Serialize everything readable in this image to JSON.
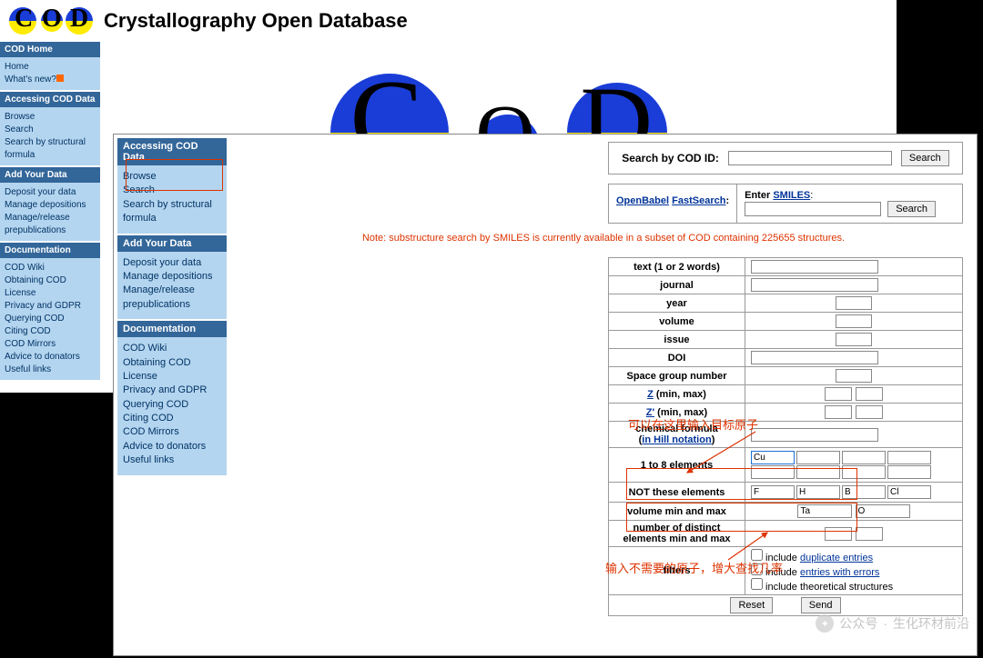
{
  "header": {
    "site_title": "Crystallography Open Database"
  },
  "sidebar1": {
    "cod_home": {
      "header": "COD Home",
      "home": "Home",
      "whats_new": "What's new?"
    },
    "accessing": {
      "header": "Accessing COD Data",
      "browse": "Browse",
      "search": "Search",
      "search_formula": "Search by structural formula"
    },
    "add": {
      "header": "Add Your Data",
      "deposit": "Deposit your data",
      "manage_dep": "Manage depositions",
      "manage_rel": "Manage/release prepublications"
    },
    "doc": {
      "header": "Documentation",
      "wiki": "COD Wiki",
      "obtaining": "Obtaining COD",
      "license": "License",
      "privacy": "Privacy and GDPR",
      "querying": "Querying COD",
      "citing": "Citing COD",
      "mirrors": "COD Mirrors",
      "advice": "Advice to donators",
      "useful": "Useful links"
    }
  },
  "sidebar2": {
    "accessing": {
      "header": "Accessing COD Data",
      "browse": "Browse",
      "search": "Search",
      "search_formula": "Search by structural formula"
    },
    "add": {
      "header": "Add Your Data",
      "deposit": "Deposit your data",
      "manage_dep": "Manage depositions",
      "manage_rel": "Manage/release prepublications"
    },
    "doc": {
      "header": "Documentation",
      "wiki": "COD Wiki",
      "obtaining": "Obtaining COD",
      "license": "License",
      "privacy": "Privacy and GDPR",
      "querying": "Querying COD",
      "citing": "Citing COD",
      "mirrors": "COD Mirrors",
      "advice": "Advice to donators",
      "useful": "Useful links"
    }
  },
  "search_cod_id": {
    "label": "Search by COD ID:",
    "button": "Search"
  },
  "smiles": {
    "openbabel": "OpenBabel",
    "fastsearch": "FastSearch",
    "enter": "Enter ",
    "smiles_link": "SMILES",
    "colon": ":",
    "button": "Search"
  },
  "note": "Note: substructure search by SMILES is currently available in a subset of COD containing 225655 structures.",
  "form": {
    "text": "text (1 or 2 words)",
    "journal": "journal",
    "year": "year",
    "volume": "volume",
    "issue": "issue",
    "doi": "DOI",
    "sg": "Space group number",
    "z": "Z",
    "z_suffix": " (min, max)",
    "zprime": "Z'",
    "zprime_suffix": " (min, max)",
    "formula": "chemical formula",
    "in_hill": "in Hill notation",
    "elements": "1 to 8 elements",
    "not_elements": "NOT these elements",
    "vol_minmax": "volume min and max",
    "distinct": "number of distinct elements min and max",
    "filters": "filters",
    "f_dup_prefix": " include ",
    "f_dup": "duplicate entries",
    "f_err_prefix": " include ",
    "f_err": "entries with errors",
    "f_theo": " include theoretical structures",
    "reset": "Reset",
    "send": "Send",
    "cu": "Cu",
    "ne_f": "F",
    "ne_h": "H",
    "ne_b": "B",
    "ne_cl": "Cl",
    "v1": "Ta",
    "v2": "O"
  },
  "annotations": {
    "target_atoms": "可以在这里输入目标原子",
    "exclude_atoms": "输入不需要的原子，增大查找几率"
  },
  "watermark": {
    "label1": "公众号",
    "label2": "生化环材前沿"
  }
}
